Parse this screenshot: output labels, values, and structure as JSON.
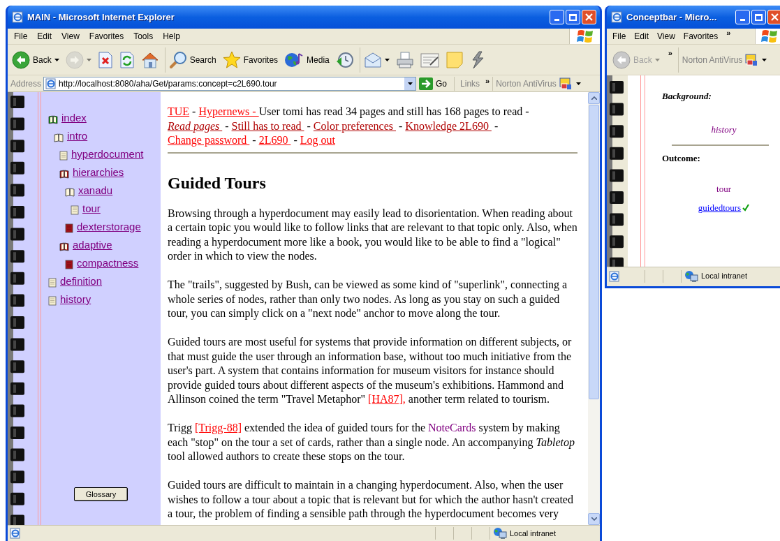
{
  "main_window": {
    "title": "MAIN - Microsoft Internet Explorer",
    "menu": [
      "File",
      "Edit",
      "View",
      "Favorites",
      "Tools",
      "Help"
    ],
    "toolbar": [
      [
        {
          "kind": "back",
          "label": "Back",
          "dropdown": true,
          "disabled": false
        },
        {
          "kind": "forward",
          "dropdown": true,
          "disabled": true
        },
        {
          "kind": "stop",
          "dropdown": false,
          "disabled": false
        },
        {
          "kind": "refresh",
          "dropdown": false,
          "disabled": false
        },
        {
          "kind": "home",
          "dropdown": false,
          "disabled": false
        }
      ],
      [
        {
          "kind": "search",
          "label": "Search",
          "dropdown": false,
          "disabled": false
        },
        {
          "kind": "favorites",
          "label": "Favorites",
          "dropdown": false,
          "disabled": false
        },
        {
          "kind": "media",
          "label": "Media",
          "dropdown": false,
          "disabled": false
        },
        {
          "kind": "history",
          "dropdown": false,
          "disabled": false
        }
      ],
      [
        {
          "kind": "mail",
          "dropdown": true,
          "disabled": false
        },
        {
          "kind": "print",
          "dropdown": false,
          "disabled": false
        },
        {
          "kind": "edit",
          "dropdown": false,
          "disabled": false
        },
        {
          "kind": "note",
          "dropdown": false,
          "disabled": false
        },
        {
          "kind": "bolt",
          "dropdown": false,
          "disabled": false
        }
      ]
    ],
    "address": {
      "label": "Address",
      "url": "http://localhost:8080/aha/Get/params:concept=c2L690.tour",
      "go": "Go",
      "links": "Links",
      "chevron": "»",
      "norton": "Norton AntiVirus"
    },
    "sidebar": {
      "tree": [
        {
          "label": "index",
          "kind": "book-green",
          "children": [
            {
              "label": "intro",
              "kind": "book-open",
              "children": [
                {
                  "label": "hyperdocument",
                  "kind": "page"
                },
                {
                  "label": "hierarchies",
                  "kind": "book-red",
                  "children": [
                    {
                      "label": "xanadu",
                      "kind": "book-open",
                      "children": [
                        {
                          "label": "tour",
                          "kind": "page"
                        }
                      ]
                    },
                    {
                      "label": "dexterstorage",
                      "kind": "page-red"
                    }
                  ]
                },
                {
                  "label": "adaptive",
                  "kind": "book-red",
                  "children": [
                    {
                      "label": "compactness",
                      "kind": "page-red"
                    }
                  ]
                }
              ]
            }
          ]
        },
        {
          "label": "definition",
          "kind": "page"
        },
        {
          "label": "history",
          "kind": "page"
        }
      ],
      "glossary_button": "Glossary"
    },
    "content": {
      "nav": [
        {
          "kind": "link",
          "text": "TUE",
          "visited": false
        },
        {
          "kind": "text",
          "text": " - "
        },
        {
          "kind": "link",
          "text": "Hypernews - ",
          "visited": false
        },
        {
          "kind": "text",
          "text": "User tomi has read 34 pages and still has 168 pages to read - "
        },
        {
          "kind": "emphasis-link",
          "text": "Read pages ",
          "visited": true
        },
        {
          "kind": "text",
          "text": " - "
        },
        {
          "kind": "link",
          "text": "Still has to read ",
          "visited": true
        },
        {
          "kind": "text",
          "text": " - "
        },
        {
          "kind": "link",
          "text": "Color preferences ",
          "visited": true
        },
        {
          "kind": "text",
          "text": " - "
        },
        {
          "kind": "link",
          "text": "Knowledge 2L690 ",
          "visited": true
        },
        {
          "kind": "text",
          "text": " - "
        },
        {
          "kind": "link",
          "text": "Change password ",
          "visited": false
        },
        {
          "kind": "text",
          "text": " - "
        },
        {
          "kind": "link",
          "text": "2L690 ",
          "visited": false
        },
        {
          "kind": "text",
          "text": " - "
        },
        {
          "kind": "link",
          "text": "Log out",
          "visited": false
        }
      ],
      "heading": "Guided Tours",
      "paragraphs": [
        [
          {
            "kind": "text",
            "text": "Browsing through a hyperdocument may easily lead to disorientation. When reading about a certain topic you would like to follow links that are relevant to that topic only. Also, when reading a hyperdocument more like a book, you would like to be able to find a \"logical\" order in which to view the nodes."
          }
        ],
        [
          {
            "kind": "text",
            "text": "The \"trails\", suggested by Bush, can be viewed as some kind of \"superlink\", connecting a whole series of nodes, rather than only two nodes. As long as you stay on such a guided tour, you can simply click on a \"next node\" anchor to move along the tour."
          }
        ],
        [
          {
            "kind": "text",
            "text": "Guided tours are most useful for systems that provide information on different subjects, or that must guide the user through an information base, without too much initiative from the user's part. A system that contains information for museum visitors for instance should provide guided tours about different aspects of the museum's exhibitions. Hammond and Allinson coined the term \"Travel Metaphor\" "
          },
          {
            "kind": "link",
            "text": "[HA87],"
          },
          {
            "kind": "text",
            "text": " another term related to tourism."
          }
        ],
        [
          {
            "kind": "text",
            "text": "Trigg "
          },
          {
            "kind": "link",
            "text": "[Trigg-88]"
          },
          {
            "kind": "text",
            "text": " extended the idea of guided tours for the "
          },
          {
            "kind": "concept",
            "text": "NoteCards"
          },
          {
            "kind": "text",
            "text": " system by making each \"stop\" on the tour a set of cards, rather than a single node. An accompanying "
          },
          {
            "kind": "emphasis",
            "text": "Tabletop"
          },
          {
            "kind": "text",
            "text": " tool allowed authors to create these stops on the tour."
          }
        ],
        [
          {
            "kind": "text",
            "text": "Guided tours are difficult to maintain in a changing hyperdocument. Also, when the user wishes to follow a tour about a topic that is relevant but for which the author hasn't created a tour, the problem of finding a sensible path through the hyperdocument becomes very"
          }
        ]
      ]
    },
    "status_bar": {
      "zone": "Local intranet"
    }
  },
  "concept_window": {
    "title": "Conceptbar - Micro...",
    "menu": [
      "File",
      "Edit",
      "View",
      "Favorites"
    ],
    "menu_more": "»",
    "toolbar": {
      "back": "Back",
      "back_disabled": true,
      "more": "»",
      "norton": "Norton AntiVirus"
    },
    "panel": {
      "background_label": "Background:",
      "background_items": [
        "history"
      ],
      "outcome_label": "Outcome:",
      "outcome_items": [
        {
          "kind": "concept",
          "text": "tour",
          "checked": false
        },
        {
          "kind": "link",
          "text": "guidedtours",
          "checked": true
        }
      ]
    },
    "status_bar": {
      "zone": "Local intranet"
    }
  }
}
